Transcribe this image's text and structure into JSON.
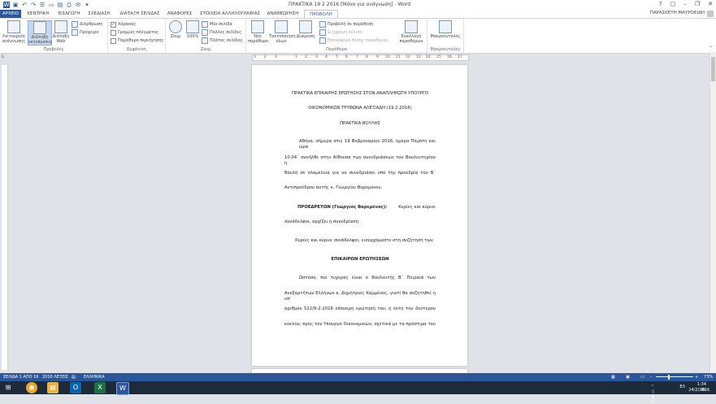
{
  "window": {
    "title": "ΠΡΑΚΤΙΚΑ 19 2 2016 [Μόνο για ανάγνωση] - Word",
    "user": "ΠΑΡΑΣΚΕΥΗ ΜΑΥΡΟΕΙΔΗ",
    "controls": [
      "?",
      "▢",
      "–",
      "❐",
      "✕"
    ]
  },
  "tabs": [
    "ΑΡΧΕΙΟ",
    "ΚΕΝΤΡΙΚΗ",
    "ΕΙΣΑΓΩΓΗ",
    "ΣΧΕΔΙΑΣΗ",
    "ΔΙΑΤΑΞΗ ΣΕΛΙΔΑΣ",
    "ΑΝΑΦΟΡΕΣ",
    "ΣΤΟΙΧΕΙΑ ΑΛΛΗΛΟΓΡΑΦΙΑΣ",
    "ΑΝΑΘΕΩΡΗΣΗ",
    "ΠΡΟΒΟΛΗ"
  ],
  "ribbon": {
    "views": {
      "read_mode": "Λειτουργία ανάγνωσης",
      "print_layout": "Διάταξη εκτυπώσεις",
      "web_layout": "Διάταξη Web",
      "outline": "Διάρθρωση",
      "draft": "Πρόχειρο",
      "label": "Προβολές"
    },
    "show": {
      "ruler": "Χάρακας",
      "gridlines": "Γραμμές πλέγματος",
      "nav_pane": "Παράθυρο περιήγησης",
      "label": "Εμφάνιση"
    },
    "zoom": {
      "zoom": "Ζουμ",
      "percent": "100%",
      "one_page": "Μία σελίδα",
      "multiple_pages": "Πολλές σελίδες",
      "page_width": "Πλάτος σελίδας",
      "label": "Ζουμ"
    },
    "window": {
      "new_window": "Νέο παράθυρο",
      "arrange_all": "Τακτοποίηση όλων",
      "split": "Διαίρεση",
      "side_by_side": "Προβολή σε παράθεση",
      "sync_scroll": "Σύγχρονη κύλιση",
      "reset_position": "Επαναφορά θέσης παραθύρου",
      "switch_windows": "Εναλλαγή παραθύρων",
      "label": "Παράθυρο"
    },
    "macros": {
      "macros": "Μακροεντολές",
      "label": "Μακροεντολές"
    }
  },
  "ruler_ticks": [
    "3",
    "2",
    "1",
    "1",
    "2",
    "3",
    "4",
    "5",
    "6",
    "7",
    "8",
    "9",
    "10",
    "11",
    "12",
    "13",
    "14",
    "15",
    "16",
    "17"
  ],
  "document": {
    "heading1": "ΠΡΑΚΤΙΚΑ ΕΠΙΚΑΙΡΗΣ ΕΡΩΤΗΣΗΣ ΣΤΟΝ ΑΝΑΠΛΗΡΩΤΗ ΥΠΟΥΡΓΟ",
    "heading2": "ΟΙΚΟΝΟΜΙΚΩΝ ΤΡΥΦΩΝΑ ΑΛΕΞΙΑΔΗ (19.2.2016)",
    "heading3": "ΠΡΑΚΤΙΚΑ ΒΟΥΛΗΣ",
    "para1_l1": "Αθήνα, σήμερα στις 19 Φεβρουαρίου 2016, ημέρα Πέμπτη και ώρα",
    "para1_l2": "10.04΄ συνήλθε στην Αίθουσα των συνεδριάσεων του Βουλευτηρίου η",
    "para1_l3": "Βουλή σε ολομέλεια για να συνεδριάσει υπό την προεδρία του Β΄",
    "para1_l4": "Αντιπροέδρου αυτής κ. Γεωργίου Βαρεμένου.",
    "para2_bold": "ΠΡΟΕΔΡΕΥΩΝ (Γεώργιος Βαρεμένος):",
    "para2_rest": "Κυρίες και κύριοι",
    "para2_l2": "συνάδελφοι, αρχίζει η συνεδρίαση.",
    "para3": "Κυρίες και κύριοι συνάδελφοι, εισερχόμαστε στη συζήτηση των",
    "heading4": "ΕΠΙΚΑΙΡΩΝ ΕΡΩΤΗΣΕΩΝ",
    "para4_l1": "Ωστόσο, πιο τυχερός είναι ο Βουλευτής Β΄ Πειραιά των",
    "para4_l2": "Ανεξαρτήτων Ελλήνων κ. Δημήτριος Καμμένος, γιατί θα συζητηθεί η υπ'",
    "para4_l3": "αριθμόν 522/9-2-2016 επίκαιρη ερώτησή του, η έκτη του δεύτερου",
    "para4_l4": "κύκλου, προς τον Υπουργό Οικονομικών, σχετικά με τα πρόστιμα του"
  },
  "status": {
    "page": "ΣΕΛΙΔΑ 1 ΑΠΟ 16",
    "words": "2010 ΛΕΞΕΙΣ",
    "language": "ΕΛΛΗΝΙΚΑ",
    "zoom": "73%"
  },
  "taskbar": {
    "apps": [
      "⊞",
      "◉",
      "▤",
      "O",
      "X",
      "W"
    ],
    "lang": "ΕΛ",
    "time": "1:34 μμ",
    "date": "24/2/2016"
  },
  "colors": {
    "accent": "#2b579a",
    "taskbar": "#1c2a3a"
  }
}
